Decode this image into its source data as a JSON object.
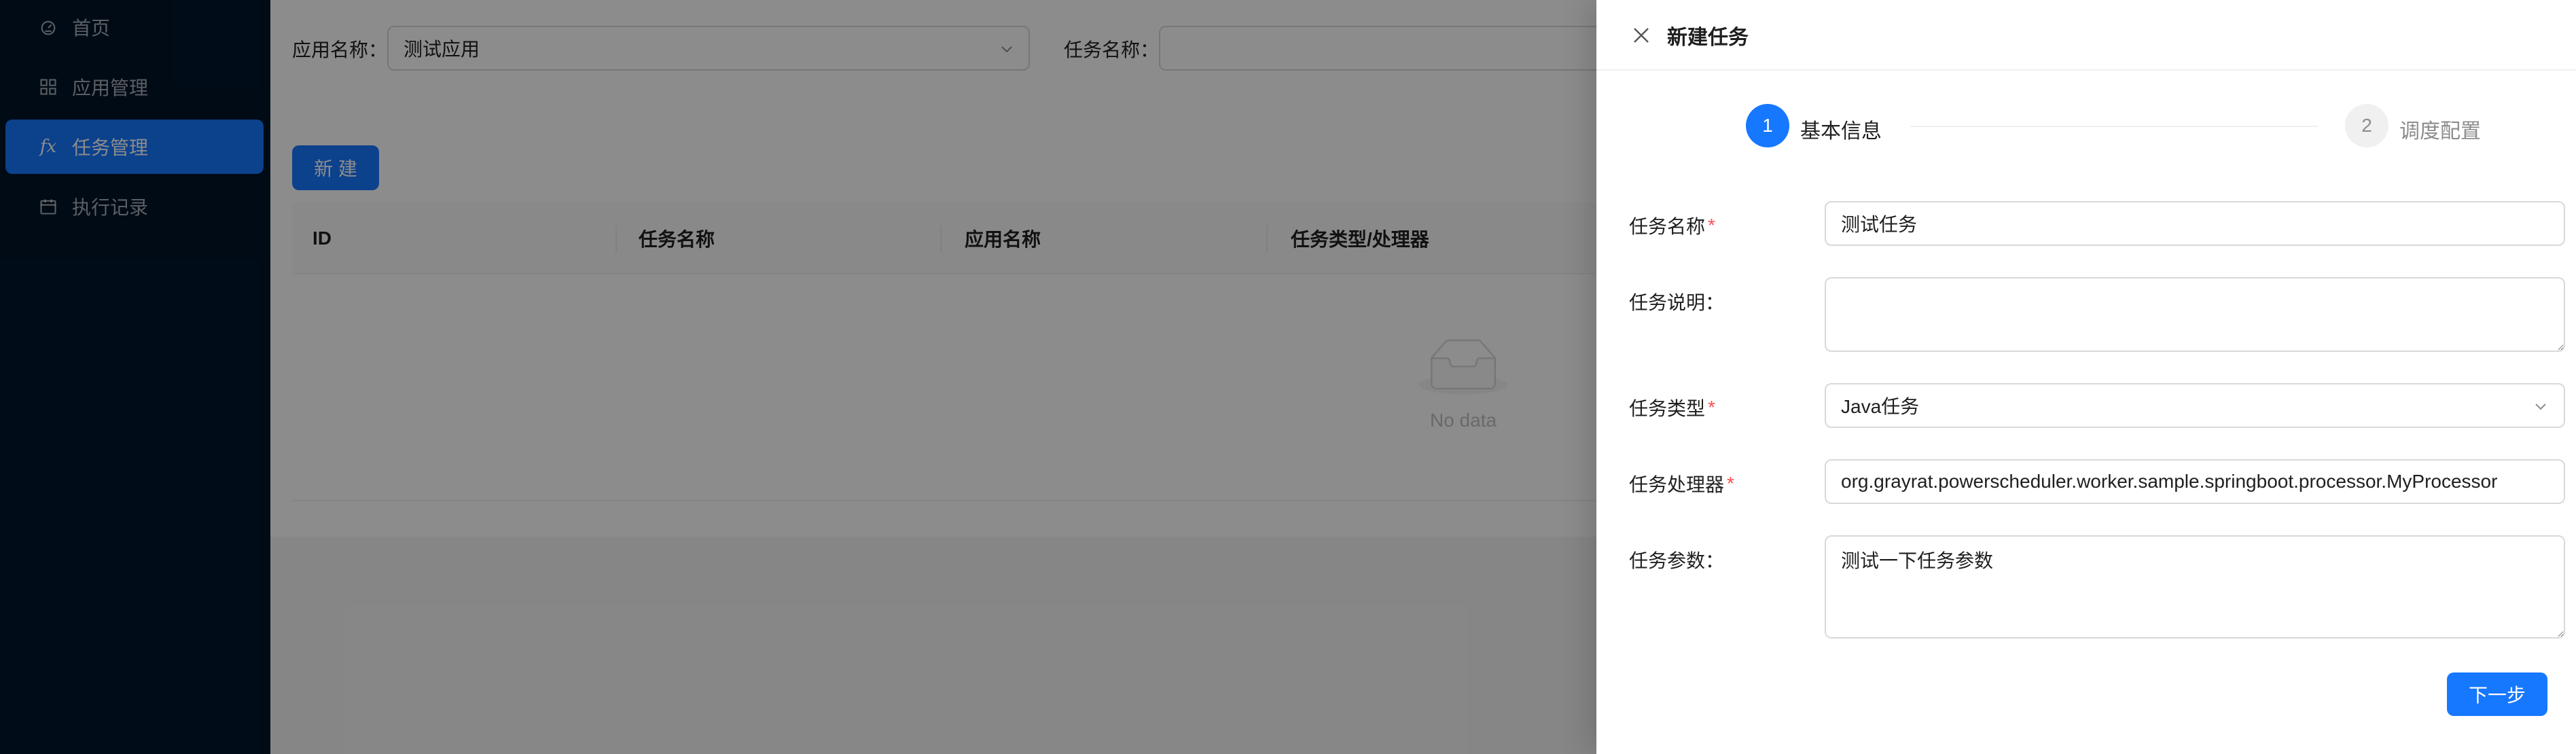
{
  "sidebar": {
    "items": [
      {
        "label": "首页",
        "icon": "dashboard-icon"
      },
      {
        "label": "应用管理",
        "icon": "appstore-icon"
      },
      {
        "label": "任务管理",
        "icon": "function-icon",
        "icon_text": "fx",
        "active": true
      },
      {
        "label": "执行记录",
        "icon": "calendar-icon"
      }
    ]
  },
  "filters": {
    "app_name_label": "应用名称：",
    "app_name_value": "测试应用",
    "task_name_label": "任务名称：",
    "task_name_value": ""
  },
  "toolbar": {
    "new_button": "新 建"
  },
  "table": {
    "columns": [
      "ID",
      "任务名称",
      "应用名称",
      "任务类型/处理器"
    ],
    "rows": [],
    "empty_text": "No data"
  },
  "drawer": {
    "title": "新建任务",
    "steps": [
      {
        "number": "1",
        "title": "基本信息",
        "status": "current"
      },
      {
        "number": "2",
        "title": "调度配置",
        "status": "wait"
      }
    ],
    "form": {
      "task_name": {
        "label": "任务名称",
        "required": true,
        "value": "测试任务"
      },
      "task_desc": {
        "label": "任务说明：",
        "required": false,
        "value": ""
      },
      "task_type": {
        "label": "任务类型",
        "required": true,
        "value": "Java任务"
      },
      "task_processor": {
        "label": "任务处理器",
        "required": true,
        "value": "org.grayrat.powerscheduler.worker.sample.springboot.processor.MyProcessor"
      },
      "task_params": {
        "label": "任务参数：",
        "required": false,
        "value": "测试一下任务参数"
      }
    },
    "next_button": "下一步"
  },
  "colors": {
    "primary": "#1677ff",
    "sidebar_bg": "#001529",
    "required_mark": "#ff4d4f",
    "mask": "rgba(0,0,0,0.45)"
  }
}
